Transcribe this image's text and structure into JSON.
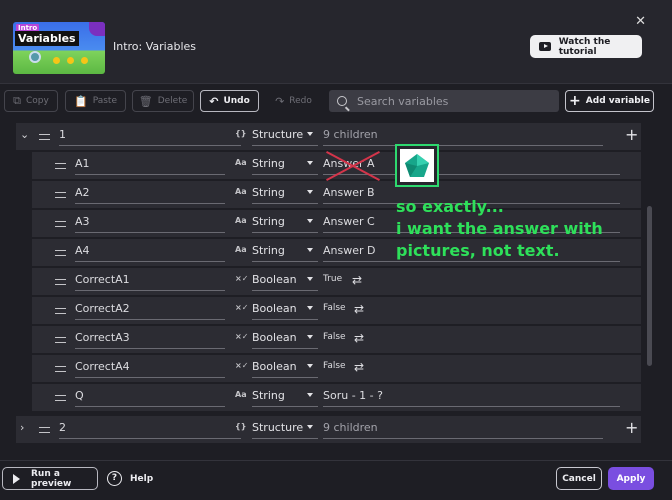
{
  "header": {
    "thumbnail": {
      "badge": "Intro",
      "title": "Variables"
    },
    "title": "Intro: Variables",
    "close_icon": "close-icon",
    "tutorial_label": "Watch the tutorial"
  },
  "toolbar": {
    "copy": "Copy",
    "paste": "Paste",
    "delete": "Delete",
    "undo": "Undo",
    "redo": "Redo",
    "search_placeholder": "Search variables",
    "add_variable": "Add variable"
  },
  "type_icons": {
    "structure": "{}",
    "string": "Aa",
    "boolean": "×✓"
  },
  "tree": {
    "groups": [
      {
        "name": "1",
        "type": "Structure",
        "value": "9 children",
        "expanded": true,
        "children": [
          {
            "name": "A1",
            "type": "String",
            "value": "Answer A"
          },
          {
            "name": "A2",
            "type": "String",
            "value": "Answer B"
          },
          {
            "name": "A3",
            "type": "String",
            "value": "Answer C"
          },
          {
            "name": "A4",
            "type": "String",
            "value": "Answer D"
          },
          {
            "name": "CorrectA1",
            "type": "Boolean",
            "value": "True"
          },
          {
            "name": "CorrectA2",
            "type": "Boolean",
            "value": "False"
          },
          {
            "name": "CorrectA3",
            "type": "Boolean",
            "value": "False"
          },
          {
            "name": "CorrectA4",
            "type": "Boolean",
            "value": "False"
          },
          {
            "name": "Q",
            "type": "String",
            "value": "Soru - 1 - ?"
          }
        ]
      },
      {
        "name": "2",
        "type": "Structure",
        "value": "9 children",
        "expanded": false
      }
    ]
  },
  "annotation": {
    "text": "so exactly...\ni want the answer with\npictures, not text.",
    "color": "#2ee05a",
    "cross_color": "#d4344a",
    "picture_icon": "pentagon-gem-icon"
  },
  "footer": {
    "run_preview": "Run a preview",
    "help": "Help",
    "cancel": "Cancel",
    "apply": "Apply"
  },
  "colors": {
    "accent": "#7a4ee0",
    "background": "#1e1e24"
  }
}
